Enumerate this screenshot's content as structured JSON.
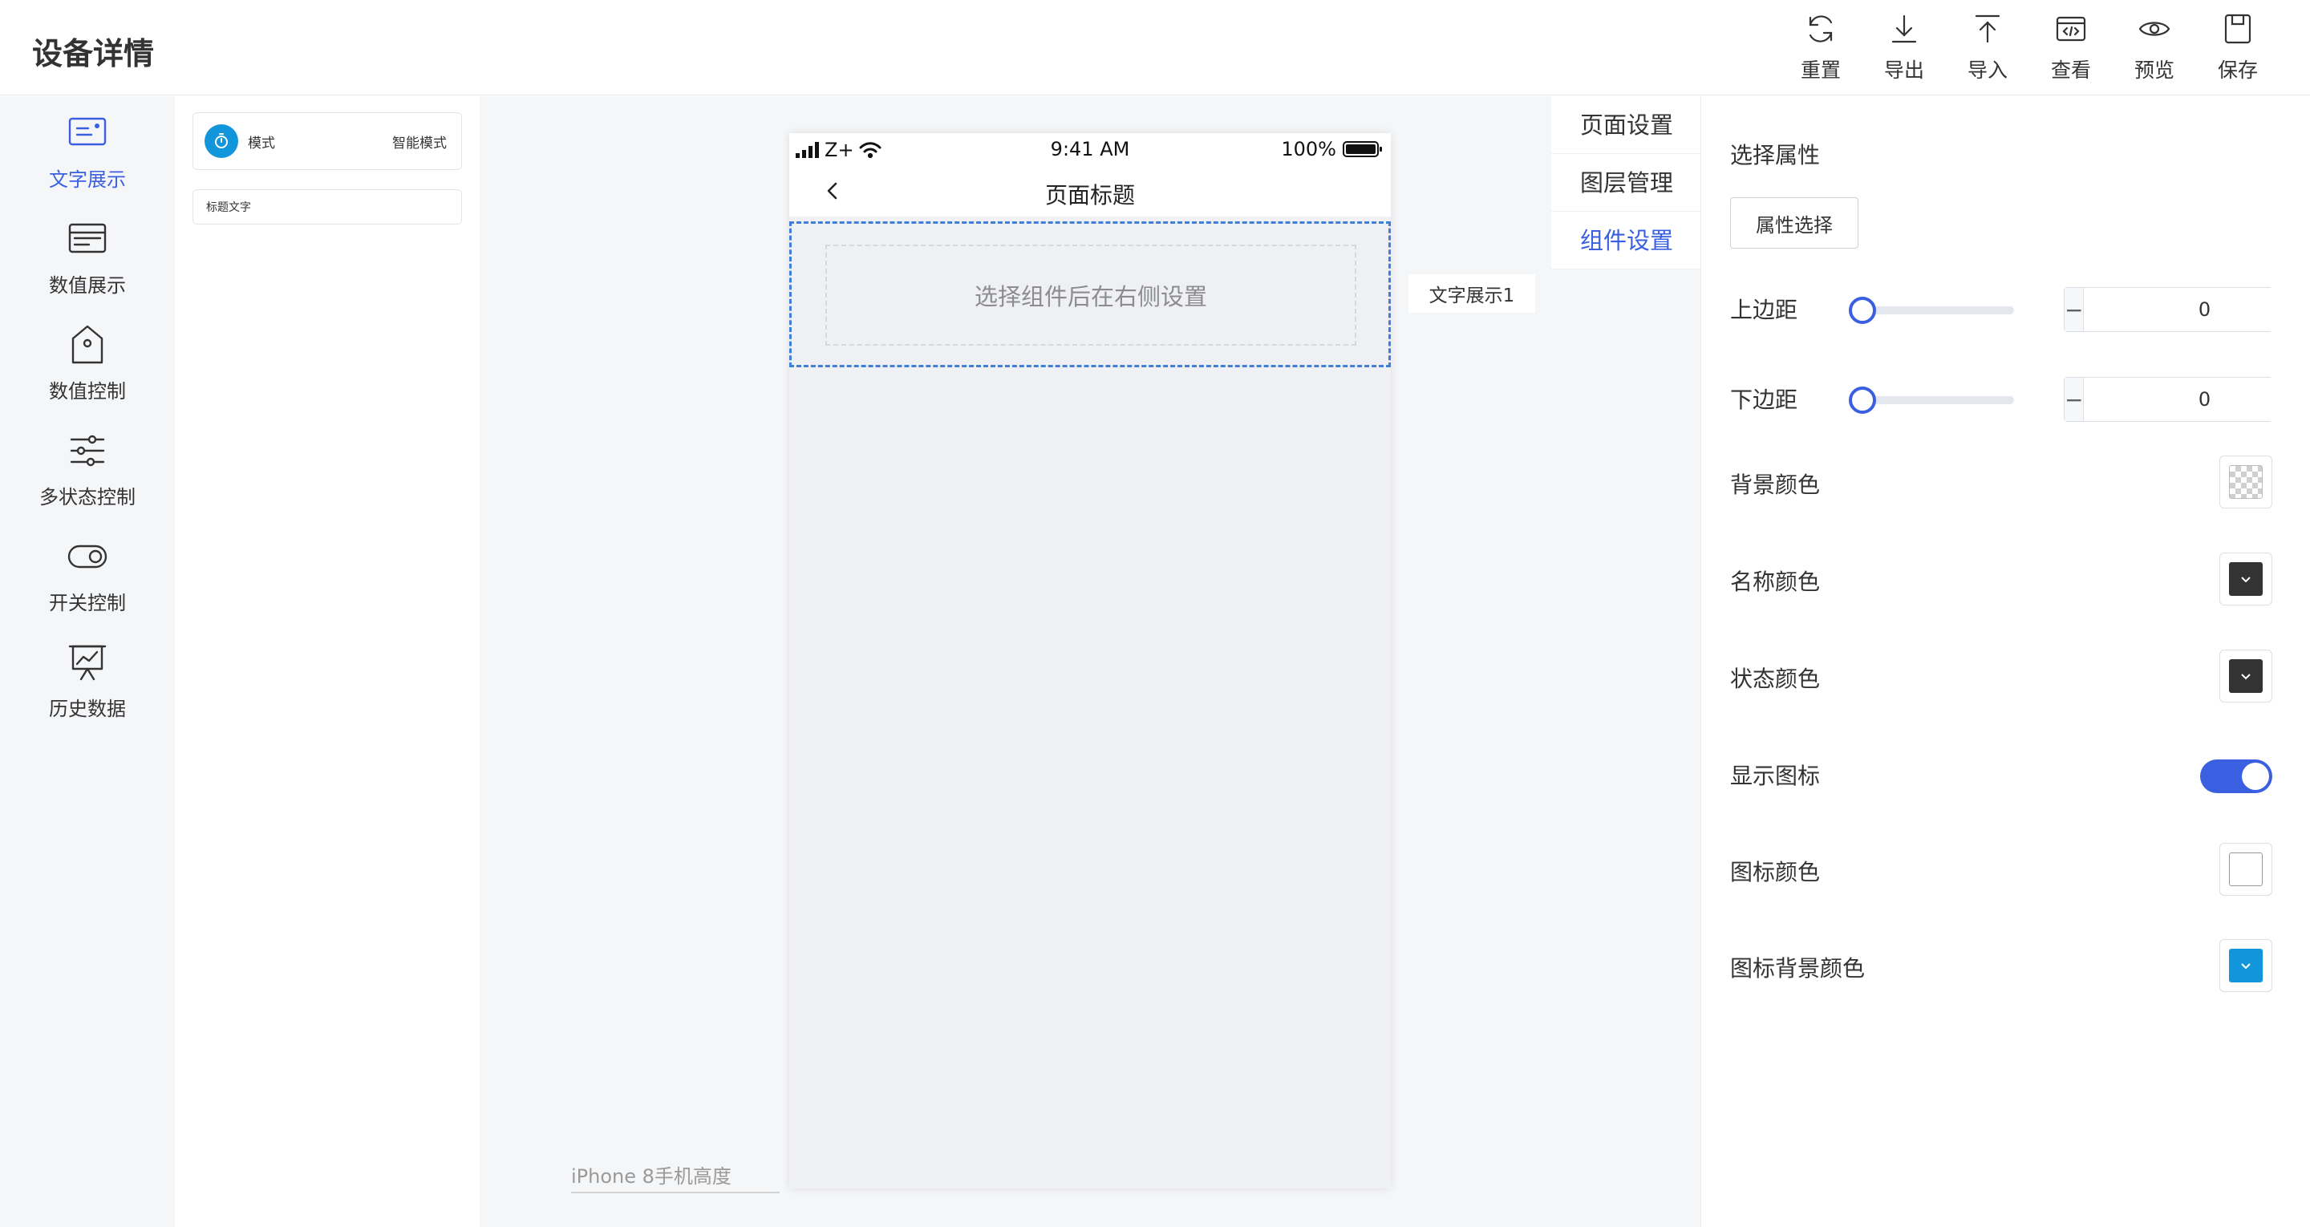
{
  "header": {
    "title": "设备详情",
    "toolbar": [
      {
        "label": "重置",
        "icon": "reset-icon"
      },
      {
        "label": "导出",
        "icon": "export-icon"
      },
      {
        "label": "导入",
        "icon": "import-icon"
      },
      {
        "label": "查看",
        "icon": "code-view-icon"
      },
      {
        "label": "预览",
        "icon": "eye-icon"
      },
      {
        "label": "保存",
        "icon": "save-icon"
      }
    ]
  },
  "categories": [
    {
      "label": "文字展示",
      "icon": "text-display-icon",
      "active": true
    },
    {
      "label": "数值展示",
      "icon": "card-icon",
      "active": false
    },
    {
      "label": "数值控制",
      "icon": "tag-icon",
      "active": false
    },
    {
      "label": "多状态控制",
      "icon": "sliders-icon",
      "active": false
    },
    {
      "label": "开关控制",
      "icon": "toggle-icon",
      "active": false
    },
    {
      "label": "历史数据",
      "icon": "chart-board-icon",
      "active": false
    }
  ],
  "components": [
    {
      "name": "模式",
      "value": "智能模式"
    },
    {
      "name": "标题文字"
    }
  ],
  "phone": {
    "carrier": "Z+",
    "time": "9:41 AM",
    "battery": "100%",
    "page_title": "页面标题",
    "placeholder": "选择组件后在右侧设置"
  },
  "layer_tag": "文字展示1",
  "device_label": "iPhone 8手机高度",
  "tabs": [
    {
      "label": "页面设置",
      "active": false
    },
    {
      "label": "图层管理",
      "active": false
    },
    {
      "label": "组件设置",
      "active": true
    }
  ],
  "props": {
    "section_title": "选择属性",
    "attr_button": "属性选择",
    "margin_top": {
      "label": "上边距",
      "value": "0",
      "slider_level": 0
    },
    "margin_bottom": {
      "label": "下边距",
      "value": "0",
      "slider_level": 0
    },
    "bg_color": {
      "label": "背景颜色",
      "color": "transparent"
    },
    "name_color": {
      "label": "名称颜色",
      "color": "#333333"
    },
    "status_color": {
      "label": "状态颜色",
      "color": "#333333"
    },
    "show_icon": {
      "label": "显示图标",
      "on": true
    },
    "icon_color": {
      "label": "图标颜色",
      "color": "#ffffff"
    },
    "icon_bg_color": {
      "label": "图标背景颜色",
      "color": "#1296db"
    }
  },
  "colors": {
    "accent": "#3a5fe0",
    "selection_border": "#3f7fd9",
    "icon_blue": "#1296db"
  }
}
